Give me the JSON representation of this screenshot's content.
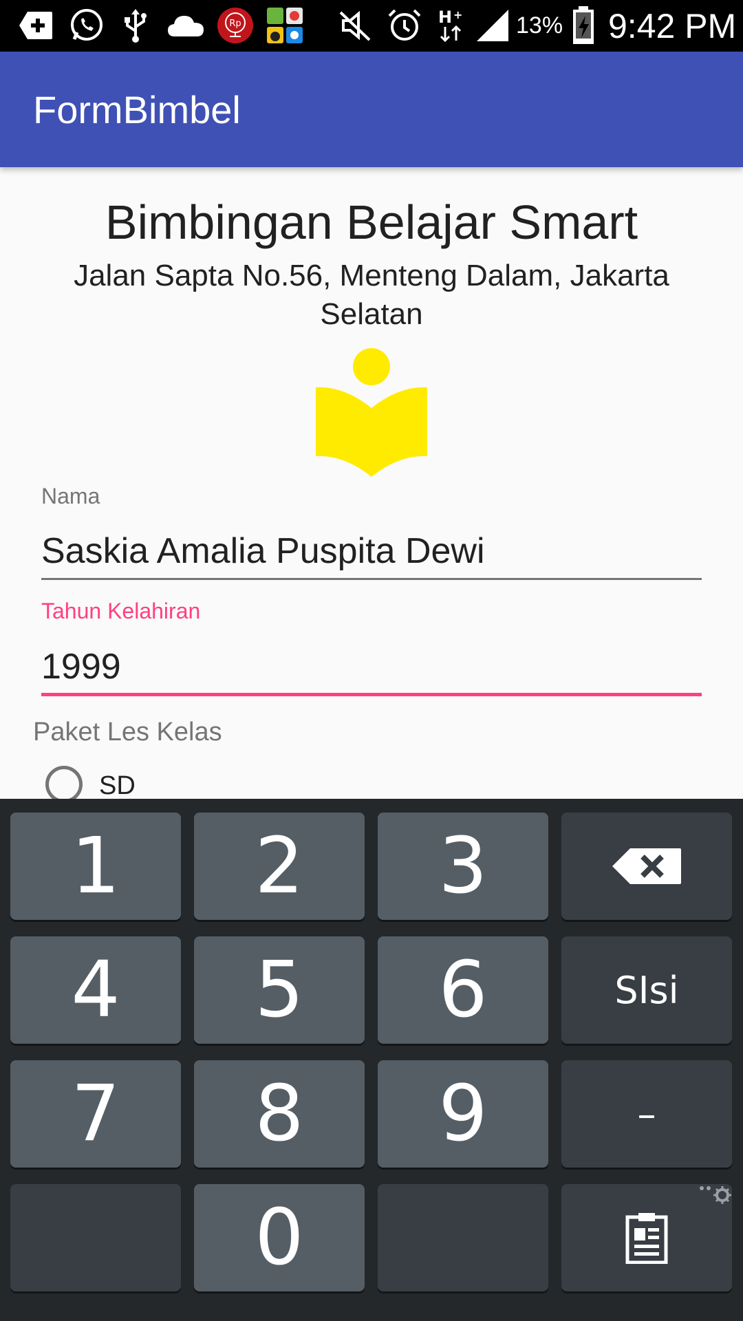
{
  "status_bar": {
    "battery_percent": "13%",
    "time": "9:42 PM",
    "icons": [
      "add-box-icon",
      "whatsapp-icon",
      "usb-icon",
      "cloud-icon",
      "rupiah-app-icon",
      "apps-folder-icon",
      "mute-icon",
      "alarm-icon",
      "hplus-data-icon",
      "signal-icon",
      "battery-charging-icon"
    ]
  },
  "app_bar": {
    "title": "FormBimbel"
  },
  "header": {
    "org_name": "Bimbingan Belajar Smart",
    "address": "Jalan Sapta No.56, Menteng Dalam, Jakarta Selatan"
  },
  "form": {
    "name_label": "Nama",
    "name_value": "Saskia Amalia Puspita Dewi",
    "year_label": "Tahun Kelahiran",
    "year_value": "1999",
    "package_label": "Paket Les Kelas",
    "option_sd": "SD"
  },
  "keyboard": {
    "keys": [
      "1",
      "2",
      "3",
      "4",
      "5",
      "6",
      "7",
      "8",
      "9",
      "0"
    ],
    "fill_label": "SIsi",
    "dash_label": "–",
    "icons": [
      "backspace-icon",
      "clipboard-icon",
      "settings-icon"
    ]
  },
  "colors": {
    "primary": "#3f51b5",
    "accent": "#ff4081",
    "logo_yellow": "#ffeb00"
  }
}
